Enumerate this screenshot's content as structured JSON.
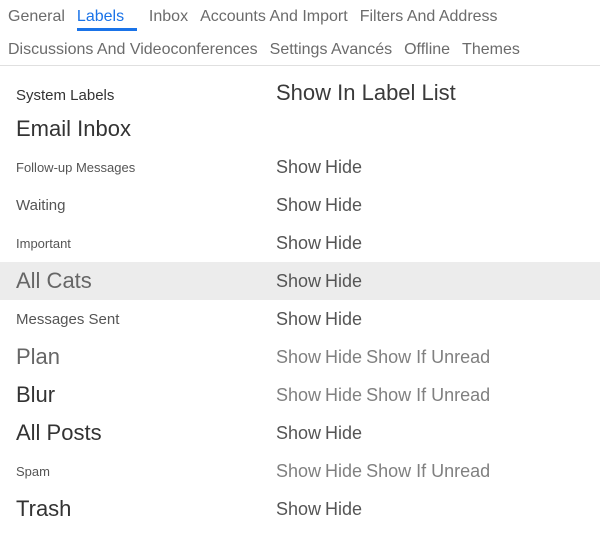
{
  "tabs": {
    "row1": [
      "General",
      "Labels",
      "Inbox",
      "Accounts And Import",
      "Filters And Address"
    ],
    "row2": [
      "Discussions And Videoconferences",
      "Settings Avancés",
      "Offline",
      "Themes"
    ],
    "active_index": 1
  },
  "section_title": "System Labels",
  "list_header": "Show In Label List",
  "action_show": "Show",
  "action_hide": "Hide",
  "action_unread": "Show If Unread",
  "rows": {
    "inbox": {
      "label": "Email Inbox"
    },
    "followup": {
      "label": "Follow-up Messages"
    },
    "waiting": {
      "label": "Waiting"
    },
    "important": {
      "label": "Important"
    },
    "allcats": {
      "label": "All Cats"
    },
    "sent": {
      "label": "Messages Sent"
    },
    "plan": {
      "label": "Plan"
    },
    "blur": {
      "label": "Blur"
    },
    "allposts": {
      "label": "All Posts"
    },
    "spam": {
      "label": "Spam"
    },
    "trash": {
      "label": "Trash"
    }
  }
}
